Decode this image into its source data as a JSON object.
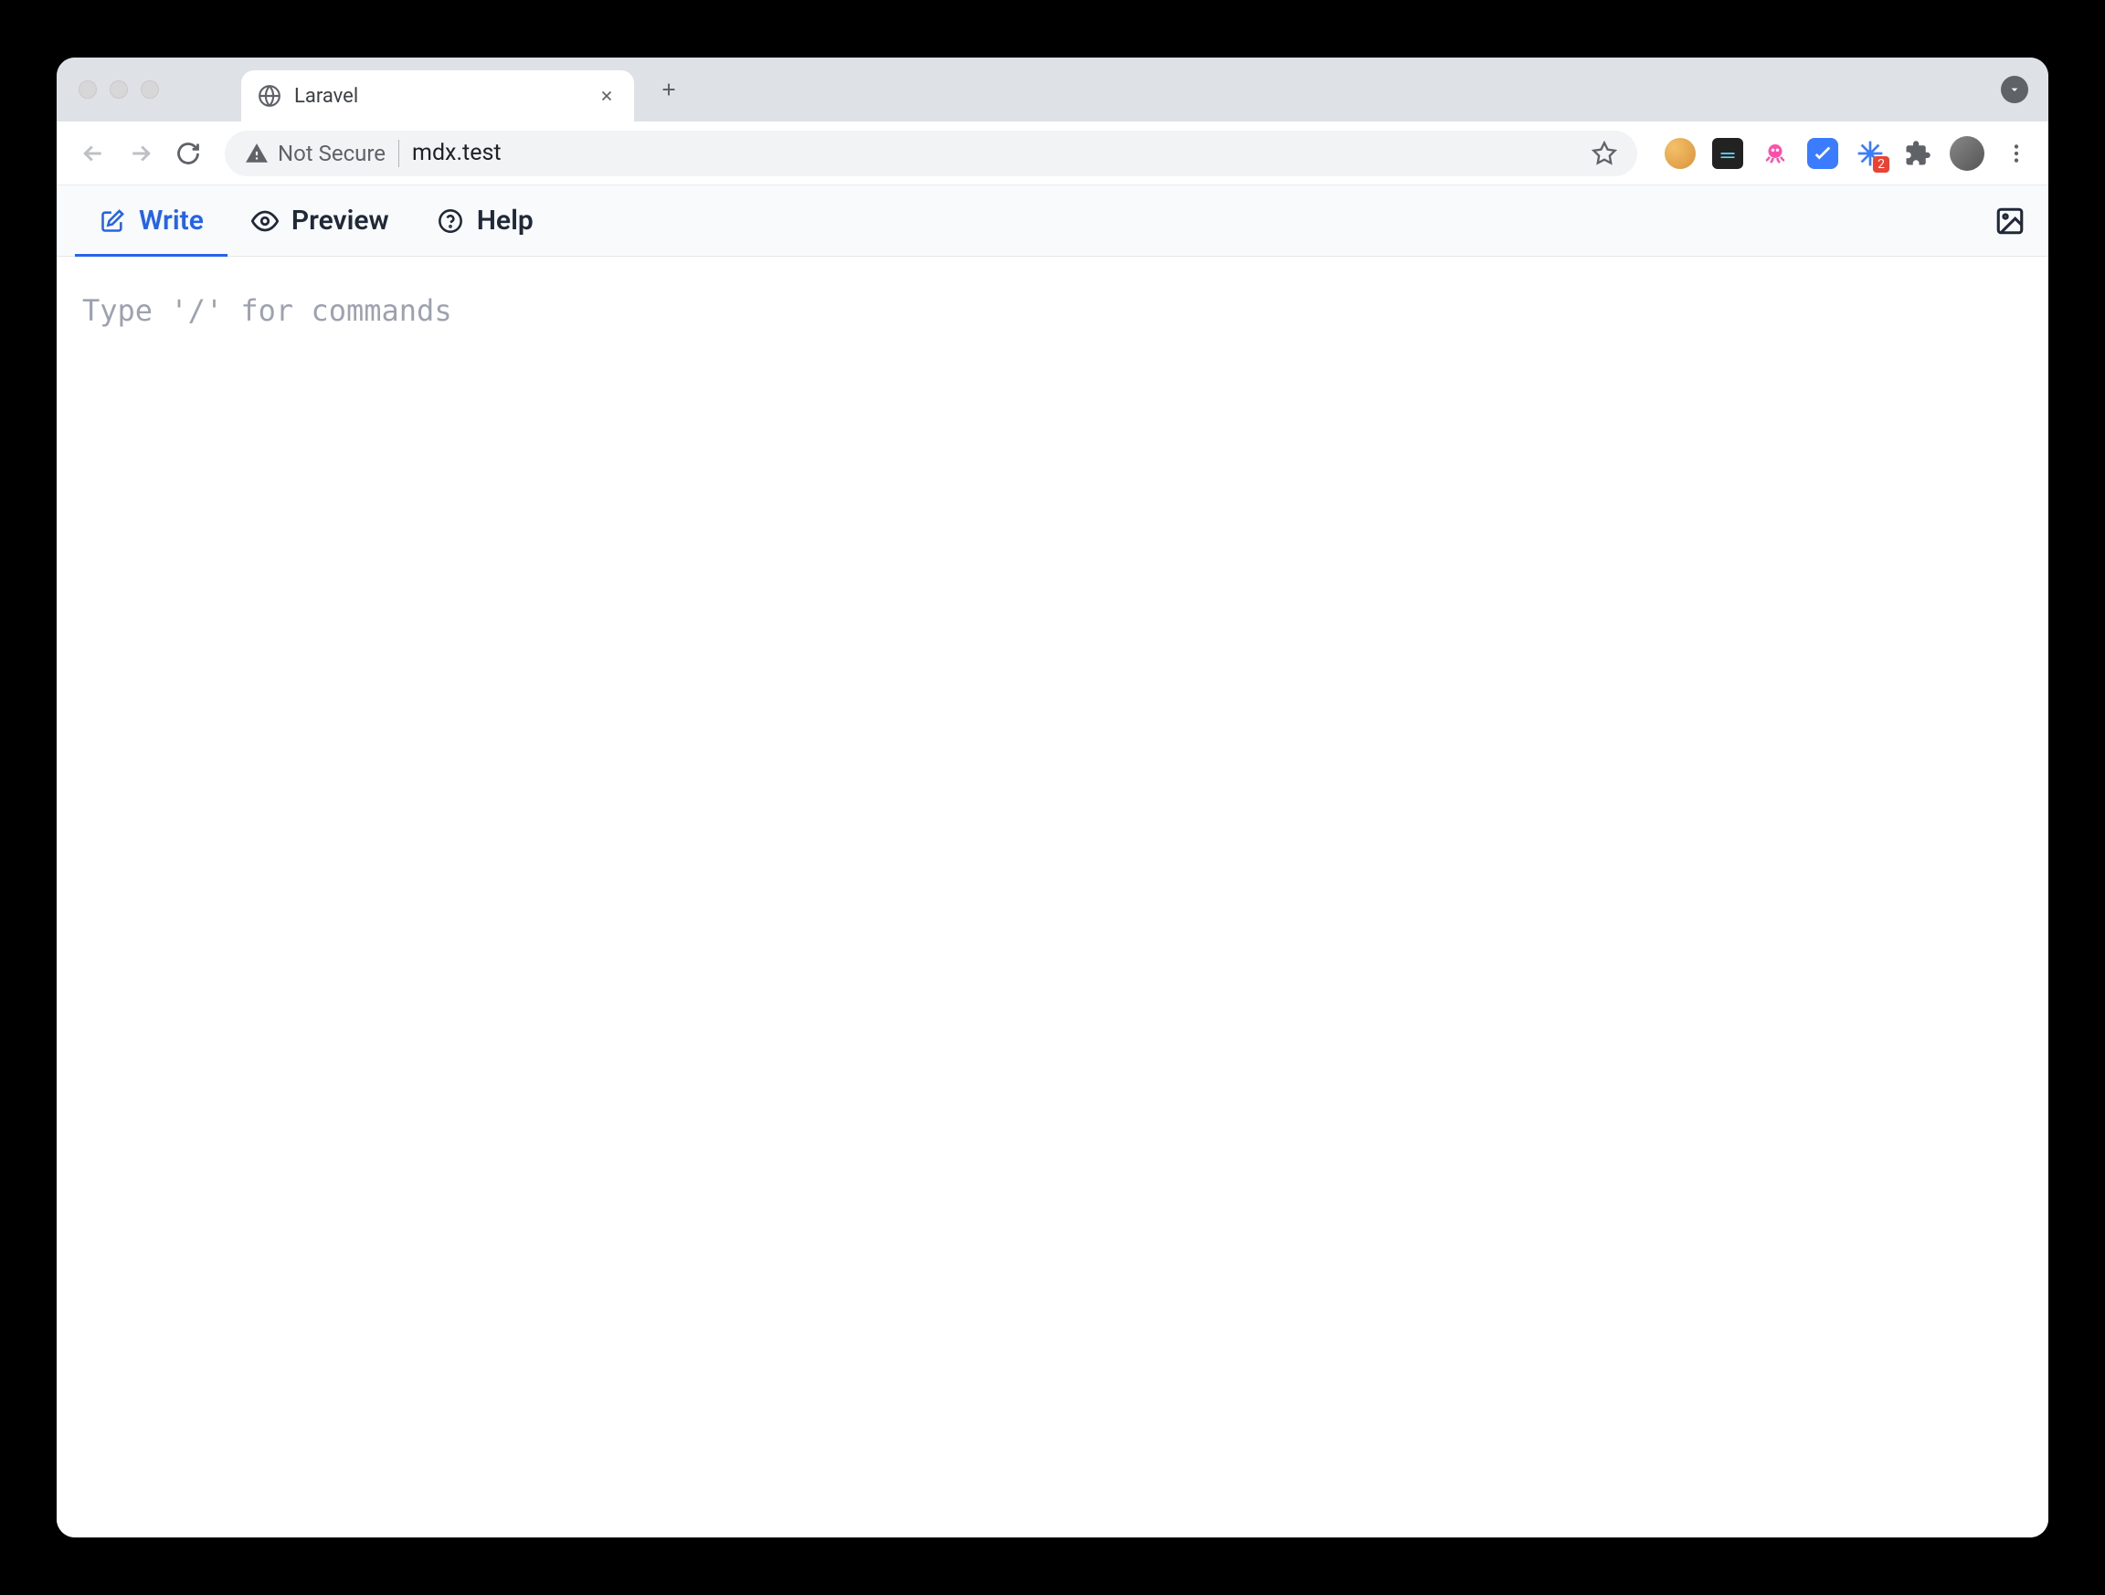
{
  "browser": {
    "tab": {
      "title": "Laravel"
    },
    "security_label": "Not Secure",
    "url": "mdx.test",
    "extension_badge": "2"
  },
  "editor": {
    "tabs": [
      {
        "label": "Write"
      },
      {
        "label": "Preview"
      },
      {
        "label": "Help"
      }
    ],
    "placeholder": "Type '/' for commands"
  },
  "colors": {
    "accent": "#2563eb",
    "text": "#1f2937",
    "placeholder": "#9ca3af"
  }
}
